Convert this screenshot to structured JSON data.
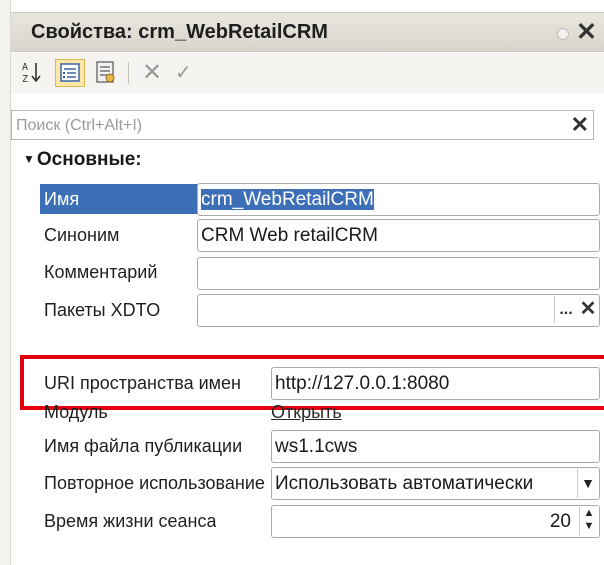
{
  "window": {
    "title": "Свойства: crm_WebRetailCRM"
  },
  "toolbar": {
    "sort_icon": "sort-alpha-icon",
    "categories_icon": "categories-icon",
    "details_icon": "details-icon",
    "cancel_label": "✕",
    "apply_label": "✓"
  },
  "search": {
    "placeholder": "Поиск (Ctrl+Alt+I)",
    "value": ""
  },
  "group": {
    "label": "Основные:"
  },
  "properties": {
    "name": {
      "label": "Имя",
      "value": "crm_WebRetailCRM"
    },
    "synonym": {
      "label": "Синоним",
      "value": "CRM Web retailCRM"
    },
    "comment": {
      "label": "Комментарий",
      "value": ""
    },
    "xdto_packages": {
      "label": "Пакеты XDTO",
      "value": "",
      "dots": "...",
      "clear": "✕"
    },
    "namespace_uri": {
      "label": "URI пространства имен",
      "value": "http://127.0.0.1:8080"
    },
    "module": {
      "label": "Модуль",
      "link": "Открыть"
    },
    "publication_file": {
      "label": "Имя файла публикации",
      "value": "ws1.1cws"
    },
    "reuse_sessions": {
      "label": "Повторное использование сеансов",
      "value": "Использовать автоматически"
    },
    "session_lifetime": {
      "label": "Время жизни сеанса",
      "value": "20"
    }
  },
  "colors": {
    "selection": "#3d6fb6",
    "highlight_border": "#e3000f",
    "active_toolbar": "#fbe8a6"
  }
}
